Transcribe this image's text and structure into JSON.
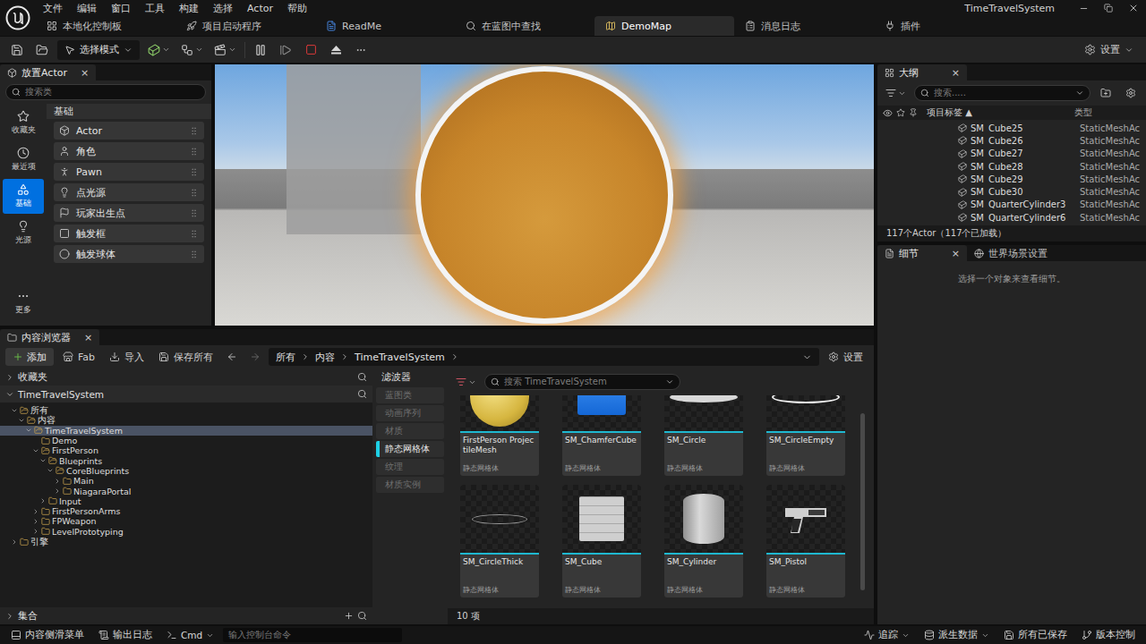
{
  "window": {
    "title": "TimeTravelSystem"
  },
  "menu": [
    "文件",
    "编辑",
    "窗口",
    "工具",
    "构建",
    "选择",
    "Actor",
    "帮助"
  ],
  "tabs": [
    {
      "label": "本地化控制板",
      "selected": false
    },
    {
      "label": "项目启动程序",
      "selected": false
    },
    {
      "label": "ReadMe",
      "selected": false
    },
    {
      "label": "在蓝图中查找",
      "selected": false
    },
    {
      "label": "DemoMap",
      "selected": true
    },
    {
      "label": "消息日志",
      "selected": false
    },
    {
      "label": "插件",
      "selected": false
    }
  ],
  "toolbar": {
    "mode": "选择模式",
    "settings": "设置"
  },
  "placeActors": {
    "title": "放置Actor",
    "close": "×",
    "search": "搜索类",
    "categories": [
      {
        "label": "收藏夹",
        "selected": false
      },
      {
        "label": "最近项",
        "selected": false
      },
      {
        "label": "基础",
        "selected": true
      },
      {
        "label": "光源",
        "selected": false
      }
    ],
    "more": "更多",
    "section": "基础",
    "items": [
      "Actor",
      "角色",
      "Pawn",
      "点光源",
      "玩家出生点",
      "触发框",
      "触发球体"
    ]
  },
  "outliner": {
    "title": "大纲",
    "close": "×",
    "search": "搜索.....",
    "columns": [
      "项目标签",
      "类型"
    ],
    "sort": "▲",
    "rows": [
      {
        "label": "SM_Cube25",
        "type": "StaticMeshAc"
      },
      {
        "label": "SM_Cube26",
        "type": "StaticMeshAc"
      },
      {
        "label": "SM_Cube27",
        "type": "StaticMeshAc"
      },
      {
        "label": "SM_Cube28",
        "type": "StaticMeshAc"
      },
      {
        "label": "SM_Cube29",
        "type": "StaticMeshAc"
      },
      {
        "label": "SM_Cube30",
        "type": "StaticMeshAc"
      },
      {
        "label": "SM_QuarterCylinder3",
        "type": "StaticMeshAc"
      },
      {
        "label": "SM_QuarterCylinder6",
        "type": "StaticMeshAc"
      }
    ],
    "footer": "117个Actor（117个已加载）"
  },
  "details": {
    "tabs": [
      {
        "label": "细节",
        "close": "×",
        "selected": true
      },
      {
        "label": "世界场景设置",
        "close": "",
        "selected": false
      }
    ],
    "empty": "选择一个对象来查看细节。"
  },
  "contentBrowser": {
    "title": "内容浏览器",
    "close": "×",
    "add": "添加",
    "fab": "Fab",
    "import": "导入",
    "saveAll": "保存所有",
    "breadcrumb": [
      "所有",
      "内容",
      "TimeTravelSystem"
    ],
    "settings": "设置",
    "favorites": "收藏夹",
    "root": "TimeTravelSystem",
    "tree": [
      {
        "label": "所有",
        "depth": 0,
        "hasChildren": true,
        "expanded": true,
        "selected": false
      },
      {
        "label": "内容",
        "depth": 1,
        "hasChildren": true,
        "expanded": true,
        "selected": false
      },
      {
        "label": "TimeTravelSystem",
        "depth": 2,
        "hasChildren": true,
        "expanded": true,
        "selected": true
      },
      {
        "label": "Demo",
        "depth": 3,
        "hasChildren": false,
        "expanded": false,
        "selected": false
      },
      {
        "label": "FirstPerson",
        "depth": 3,
        "hasChildren": true,
        "expanded": true,
        "selected": false
      },
      {
        "label": "Blueprints",
        "depth": 4,
        "hasChildren": true,
        "expanded": true,
        "selected": false
      },
      {
        "label": "CoreBlueprints",
        "depth": 5,
        "hasChildren": true,
        "expanded": true,
        "selected": false
      },
      {
        "label": "Main",
        "depth": 6,
        "hasChildren": true,
        "expanded": false,
        "selected": false
      },
      {
        "label": "NiagaraPortal",
        "depth": 6,
        "hasChildren": true,
        "expanded": false,
        "selected": false
      },
      {
        "label": "Input",
        "depth": 4,
        "hasChildren": true,
        "expanded": false,
        "selected": false
      },
      {
        "label": "FirstPersonArms",
        "depth": 3,
        "hasChildren": true,
        "expanded": false,
        "selected": false
      },
      {
        "label": "FPWeapon",
        "depth": 3,
        "hasChildren": true,
        "expanded": false,
        "selected": false
      },
      {
        "label": "LevelPrototyping",
        "depth": 3,
        "hasChildren": true,
        "expanded": false,
        "selected": false
      },
      {
        "label": "引擎",
        "depth": 0,
        "hasChildren": true,
        "expanded": false,
        "selected": false
      }
    ],
    "collections": "集合",
    "filterTitle": "滤波器",
    "filters": [
      {
        "label": "蓝图类",
        "selected": false
      },
      {
        "label": "动画序列",
        "selected": false
      },
      {
        "label": "材质",
        "selected": false
      },
      {
        "label": "静态网格体",
        "selected": true
      },
      {
        "label": "纹理",
        "selected": false
      },
      {
        "label": "材质实例",
        "selected": false
      }
    ],
    "search": "搜索 TimeTravelSystem",
    "assets": [
      {
        "name": "FirstPerson ProjectileMesh",
        "type": "静态网格体",
        "kind": "sphere"
      },
      {
        "name": "SM_ChamferCube",
        "type": "静态网格体",
        "kind": "bluecube"
      },
      {
        "name": "SM_Circle",
        "type": "静态网格体",
        "kind": "disc"
      },
      {
        "name": "SM_CircleEmpty",
        "type": "静态网格体",
        "kind": "ring"
      },
      {
        "name": "SM_CircleThick",
        "type": "静态网格体",
        "kind": "thinring"
      },
      {
        "name": "SM_Cube",
        "type": "静态网格体",
        "kind": "cube"
      },
      {
        "name": "SM_Cylinder",
        "type": "静态网格体",
        "kind": "cylinder"
      },
      {
        "name": "SM_Pistol",
        "type": "静态网格体",
        "kind": "pistol"
      }
    ],
    "count": "10 项"
  },
  "statusBar": {
    "drawer": "内容侧滑菜单",
    "log": "输出日志",
    "cmd": "Cmd",
    "console": "输入控制台命令",
    "trace": "追踪",
    "ddc": "派生数据",
    "saved": "所有已保存",
    "vcs": "版本控制"
  }
}
